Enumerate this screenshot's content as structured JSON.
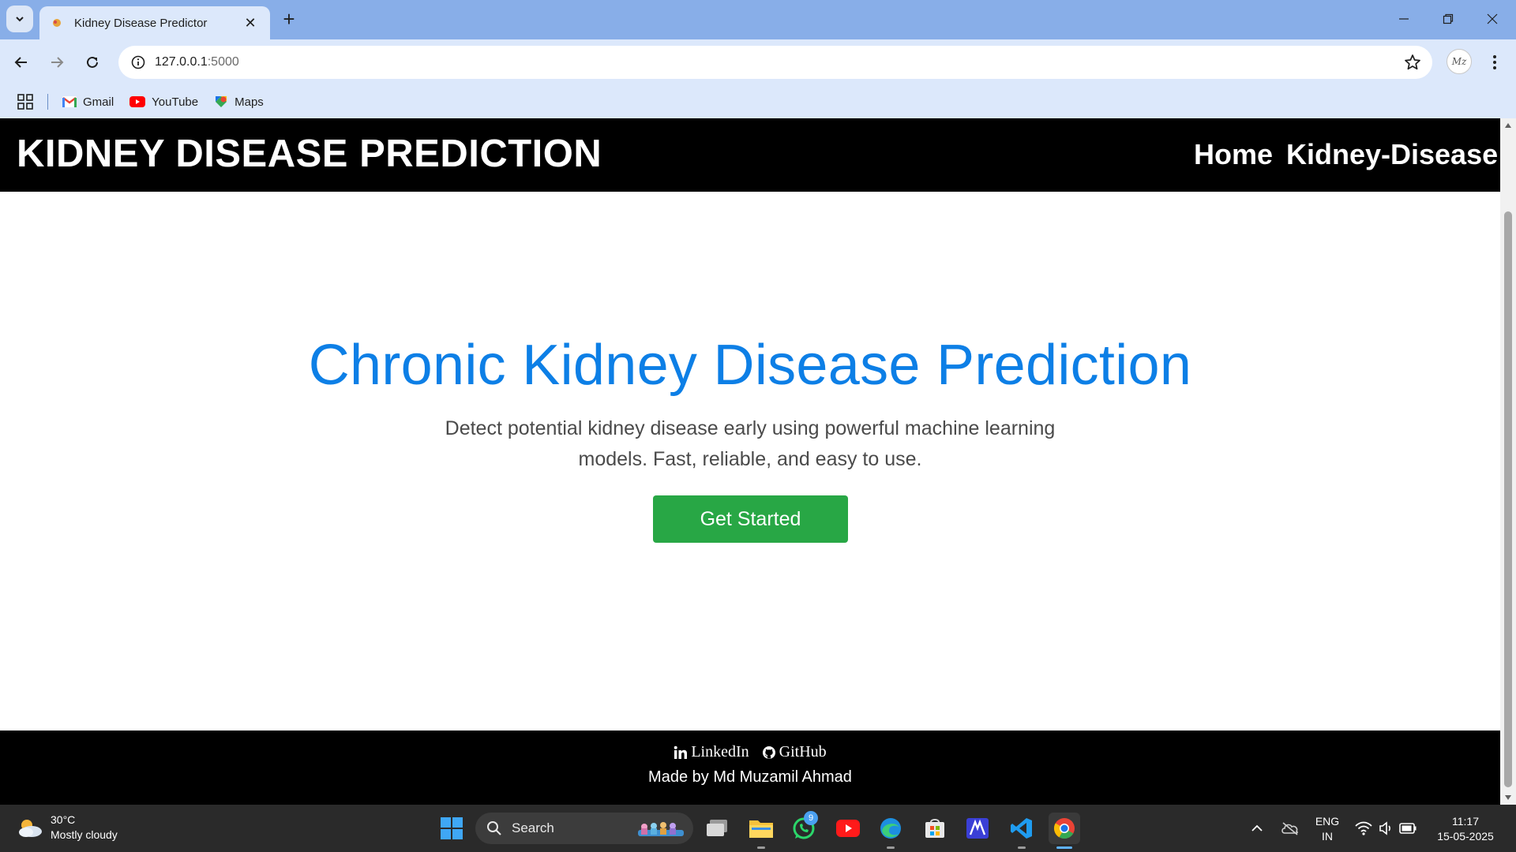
{
  "browser": {
    "tab": {
      "title": "Kidney Disease Predictor"
    },
    "address": {
      "host": "127.0.0.1",
      "port": ":5000"
    },
    "bookmarks": [
      {
        "label": "Gmail"
      },
      {
        "label": "YouTube"
      },
      {
        "label": "Maps"
      }
    ],
    "profile_initials": "Mz"
  },
  "page": {
    "navbar": {
      "brand": "KIDNEY DISEASE PREDICTION",
      "links": [
        "Home",
        "Kidney-Disease"
      ]
    },
    "hero": {
      "title": "Chronic Kidney Disease Prediction",
      "subtitle": "Detect potential kidney disease early using powerful machine learning models. Fast, reliable, and easy to use.",
      "cta_label": "Get Started"
    },
    "footer": {
      "links": [
        "LinkedIn",
        "GitHub"
      ],
      "credit": "Made by Md Muzamil Ahmad"
    },
    "colors": {
      "accent_blue": "#0d7fe6",
      "cta_green": "#28a745",
      "navbar_bg": "#000000"
    }
  },
  "taskbar": {
    "weather": {
      "temp": "30°C",
      "condition": "Mostly cloudy"
    },
    "search_label": "Search",
    "whatsapp_badge": "9",
    "lang": {
      "line1": "ENG",
      "line2": "IN"
    },
    "clock": {
      "time": "11:17",
      "date": "15-05-2025"
    }
  }
}
